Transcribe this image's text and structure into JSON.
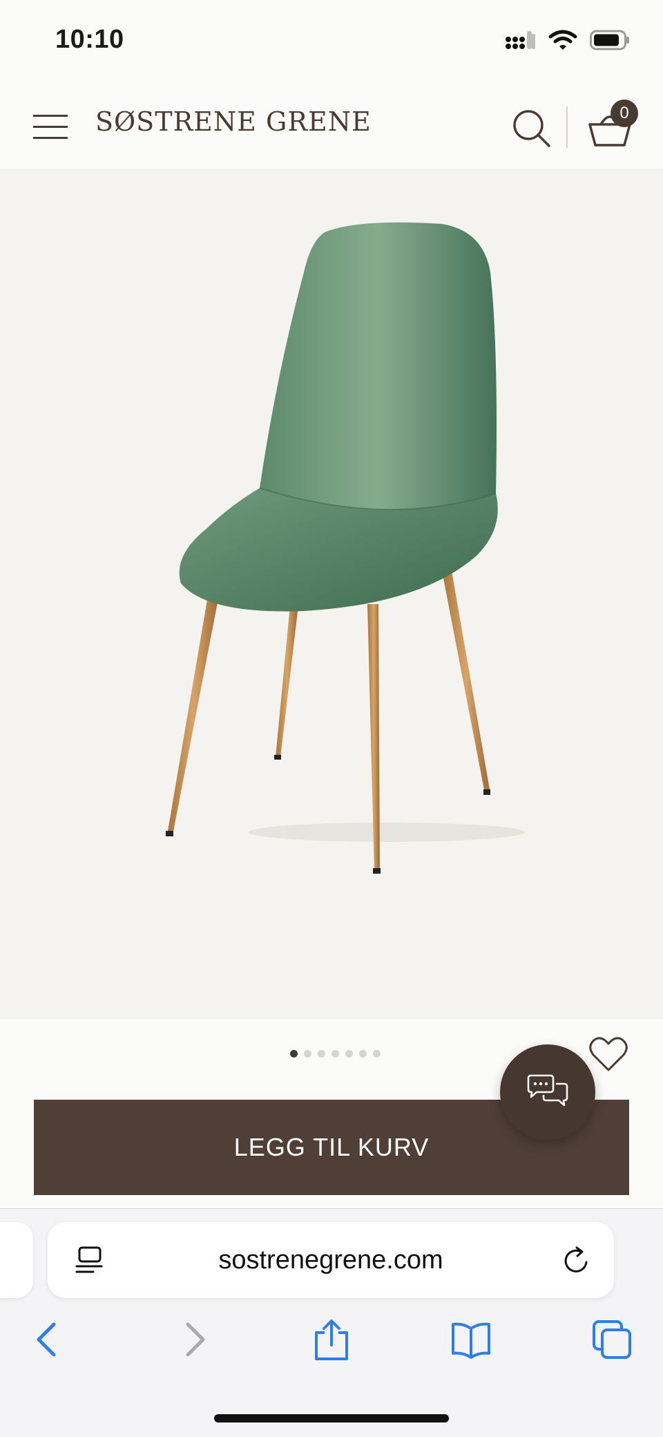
{
  "status_bar": {
    "time": "10:10"
  },
  "header": {
    "brand": "SØSTRENE GRENE",
    "cart_count": "0"
  },
  "product": {
    "image_alt": "Green velvet chair with wooden legs",
    "carousel_total": 7,
    "carousel_active": 1
  },
  "actions": {
    "add_to_cart_label": "LEGG TIL KURV"
  },
  "browser": {
    "url": "sostrenegrene.com"
  },
  "colors": {
    "brand_brown": "#4f3f36",
    "badge_brown": "#4a3b32",
    "link_blue": "#2f7ee8"
  },
  "icons": {
    "menu": "menu-icon",
    "search": "search-icon",
    "cart": "basket-icon",
    "favorite": "heart-icon",
    "chat": "chat-icon",
    "back": "chevron-left-icon",
    "forward": "chevron-right-icon",
    "share": "share-icon",
    "bookmarks": "book-icon",
    "tabs": "tabs-icon"
  }
}
